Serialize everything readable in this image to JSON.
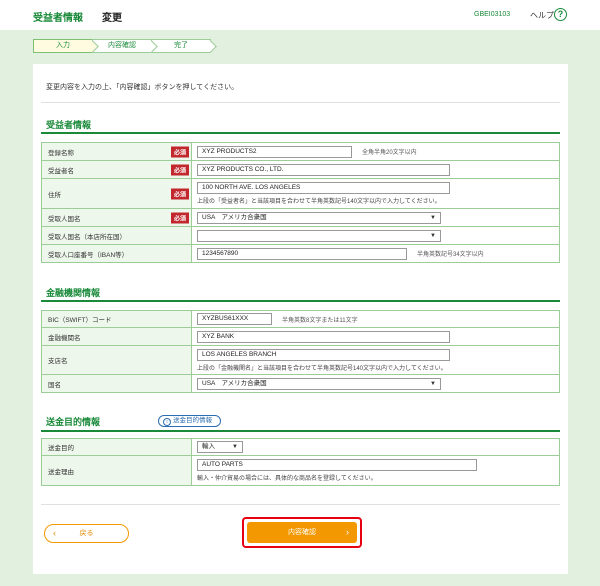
{
  "header": {
    "title": "受益者情報",
    "subtitle": "変更",
    "screen_id": "GBEI03103",
    "help_label": "ヘルプ",
    "help_icon": "?"
  },
  "steps": [
    "入力",
    "内容確認",
    "完了"
  ],
  "intro": "変更内容を入力の上、「内容確認」ボタンを押してください。",
  "required_label": "必須",
  "beneficiary": {
    "section_title": "受益者情報",
    "registered_name_label": "登録名称",
    "registered_name": "XYZ PRODUCTS2",
    "registered_name_hint": "全角半角20文字以内",
    "beneficiary_name_label": "受益者名",
    "beneficiary_name": "XYZ PRODUCTS CO., LTD.",
    "address_label": "住所",
    "address": "100 NORTH AVE. LOS ANGELES",
    "address_note": "上段の「受益者名」と当該項目を合わせて半角英数記号140文字以内で入力してください。",
    "country_label": "受取人国名",
    "country": "USA　アメリカ合衆国",
    "hq_country_label": "受取人国名（本店所在国）",
    "hq_country": "",
    "account_label": "受取人口座番号（IBAN等）",
    "account": "1234567890",
    "account_hint": "半角英数記号34文字以内"
  },
  "bank": {
    "section_title": "金融機関情報",
    "bic_label": "BIC（SWIFT）コード",
    "bic": "XYZBUS61XXX",
    "bic_hint": "半角英数8文字または11文字",
    "bank_name_label": "金融機関名",
    "bank_name": "XYZ BANK",
    "branch_label": "支店名",
    "branch": "LOS ANGELES BRANCH",
    "branch_note": "上段の「金融機関名」と当該項目を合わせて半角英数記号140文字以内で入力してください。",
    "country_label": "国名",
    "country": "USA　アメリカ合衆国"
  },
  "purpose": {
    "section_title": "送金目的情報",
    "info_button": "送金目的情報",
    "purpose_label": "送金目的",
    "purpose": "輸入",
    "reason_label": "送金理由",
    "reason": "AUTO PARTS",
    "reason_note": "輸入・仲介貿易の場合には、具体的な商品名を登録してください。"
  },
  "buttons": {
    "back": "戻る",
    "confirm": "内容確認"
  }
}
